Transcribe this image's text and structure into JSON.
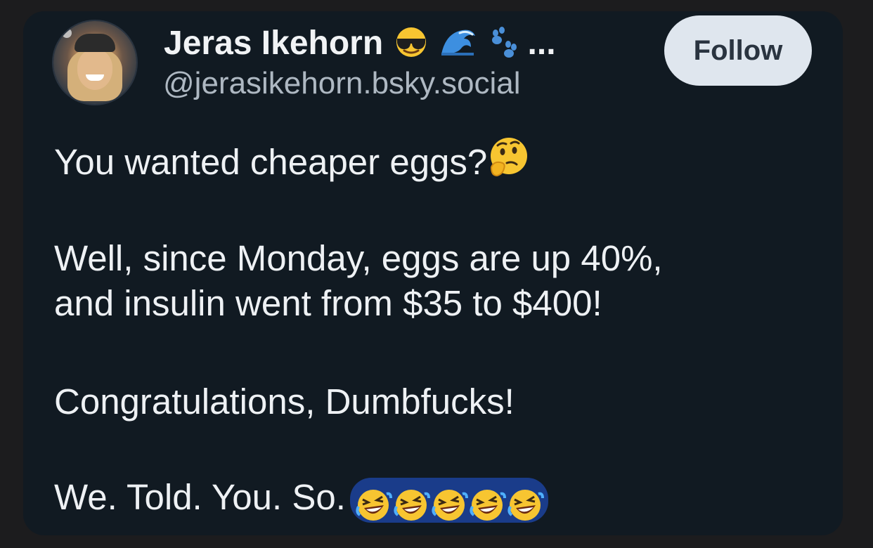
{
  "author": {
    "display_name": "Jeras Ikehorn",
    "name_emojis": [
      "sunglasses-face-emoji",
      "water-wave-emoji",
      "paw-prints-emoji"
    ],
    "name_ellipsis": "...",
    "handle": "@jerasikehorn.bsky.social",
    "avatar_icon": "avatar-photo"
  },
  "follow_button": {
    "label": "Follow"
  },
  "post": {
    "line1": "You wanted cheaper eggs?",
    "line1_emoji": "thinking-face-emoji",
    "line2a": "Well, since Monday, eggs are up 40%,",
    "line2b": "and insulin went from $35 to $400!",
    "line3": "Congratulations, Dumbfucks!",
    "line4": "We. Told. You. So.",
    "line4_emojis": [
      "rolling-on-floor-laughing-emoji",
      "rolling-on-floor-laughing-emoji",
      "rolling-on-floor-laughing-emoji",
      "rolling-on-floor-laughing-emoji",
      "rolling-on-floor-laughing-emoji"
    ]
  },
  "colors": {
    "background": "#1c1c1e",
    "card": "#111a22",
    "text": "#eef1f4",
    "handle": "#aeb8c2",
    "follow_bg": "#dfe6ee",
    "follow_text": "#2a3440",
    "emoji_highlight": "#1a3c8a"
  }
}
